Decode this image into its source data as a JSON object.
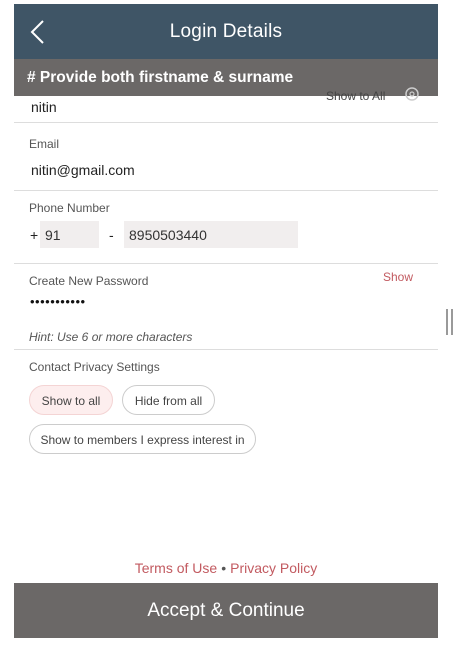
{
  "header": {
    "title": "Login Details"
  },
  "notice": {
    "text": "# Provide both firstname & surname"
  },
  "name_row": {
    "value": "nitin",
    "visibility_label": "Show to All"
  },
  "email": {
    "label": "Email",
    "value": "nitin@gmail.com"
  },
  "phone": {
    "label": "Phone Number",
    "plus": "+",
    "country_code": "91",
    "separator": "-",
    "number": "8950503440"
  },
  "password": {
    "label": "Create New Password",
    "show_label": "Show",
    "masked_value": "•••••••••••",
    "hint": "Hint: Use 6 or more characters"
  },
  "privacy": {
    "label": "Contact Privacy Settings",
    "options": [
      {
        "label": "Show to all",
        "selected": true
      },
      {
        "label": "Hide from all",
        "selected": false
      },
      {
        "label": "Show to members I express interest in",
        "selected": false
      }
    ]
  },
  "footer": {
    "terms_label": "Terms of Use",
    "separator": "•",
    "privacy_label": "Privacy Policy"
  },
  "accept_button": {
    "label": "Accept & Continue"
  },
  "colors": {
    "header_bg": "#3f5566",
    "banner_bg": "#6b6867",
    "link": "#c25a60",
    "input_bg": "#f1eeee",
    "selected_pill_bg": "#fdeeee"
  },
  "icons": {
    "back": "chevron-left-icon",
    "gear": "gear-icon",
    "scroll": "drag-handle-icon"
  }
}
